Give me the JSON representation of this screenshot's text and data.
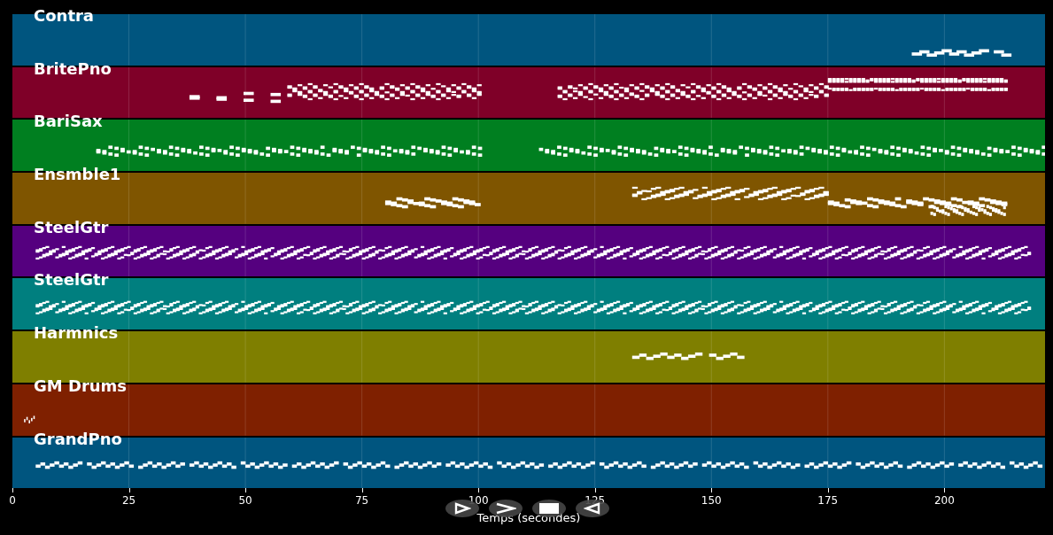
{
  "tracks": [
    {
      "name": "Contra",
      "color": "#00557f"
    },
    {
      "name": "BritePno",
      "color": "#7f0028"
    },
    {
      "name": "BariSax",
      "color": "#007f20"
    },
    {
      "name": "Ensmble1",
      "color": "#7f5500"
    },
    {
      "name": "SteelGtr",
      "color": "#55007f"
    },
    {
      "name": "SteelGtr",
      "color": "#007f7f"
    },
    {
      "name": "Harmnics",
      "color": "#7f7f00"
    },
    {
      "name": "GM Drums",
      "color": "#7f2000"
    },
    {
      "name": "GrandPno",
      "color": "#00557f"
    }
  ],
  "axis": {
    "xticks": [
      "0",
      "25",
      "50",
      "75",
      "100",
      "125",
      "150",
      "175",
      "200"
    ],
    "xlabel": "Temps (secondes)"
  },
  "controls": [
    {
      "kind": "play"
    },
    {
      "kind": "forward"
    },
    {
      "kind": "stop"
    },
    {
      "kind": "back"
    }
  ]
}
